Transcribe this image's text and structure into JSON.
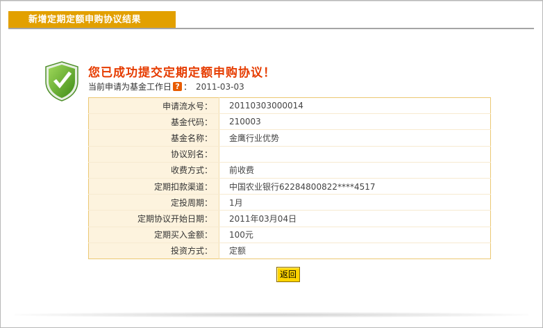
{
  "header": {
    "title": "新增定期定额申购协议结果"
  },
  "result": {
    "icon": "check-shield-icon",
    "title": "您已成功提交定期定额申购协议！",
    "workday_label": "当前申请为基金工作日",
    "help_glyph": "?",
    "workday_colon": "：",
    "workday_date": "2011-03-03"
  },
  "details": [
    {
      "label": "申请流水号：",
      "value": "20110303000014"
    },
    {
      "label": "基金代码：",
      "value": "210003"
    },
    {
      "label": "基金名称：",
      "value": "金鹰行业优势"
    },
    {
      "label": "协议别名：",
      "value": ""
    },
    {
      "label": "收费方式：",
      "value": "前收费"
    },
    {
      "label": "定期扣款渠道：",
      "value": "中国农业银行62284800822****4517"
    },
    {
      "label": "定投周期：",
      "value": "1月"
    },
    {
      "label": "定期协议开始日期：",
      "value": "2011年03月04日"
    },
    {
      "label": "定期买入金额：",
      "value": "100元"
    },
    {
      "label": "投资方式：",
      "value": "定额"
    }
  ],
  "actions": {
    "back_label": "返回"
  },
  "colors": {
    "accent": "#e2a000",
    "success_text": "#e63c00",
    "label_bg": "#fdf3de",
    "table_border": "#ebc772",
    "button_bg": "#ffd400",
    "shield_green": "#5aa828"
  }
}
